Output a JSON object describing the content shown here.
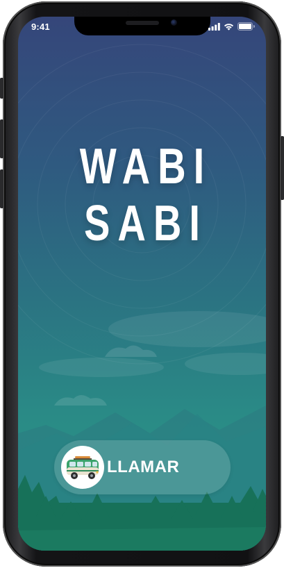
{
  "status_bar": {
    "time": "9:41",
    "icons": [
      "cellular-signal-icon",
      "wifi-icon",
      "battery-icon"
    ]
  },
  "title": {
    "line1": "WABI",
    "line2": "SABI"
  },
  "call_button": {
    "label": "LLAMAR",
    "icon": "van-icon"
  },
  "colors": {
    "gradient_top": "#35467a",
    "gradient_bottom": "#2a9488",
    "mountains_back": "#2f7c80",
    "forest": "#17705a",
    "text": "#ffffff"
  }
}
